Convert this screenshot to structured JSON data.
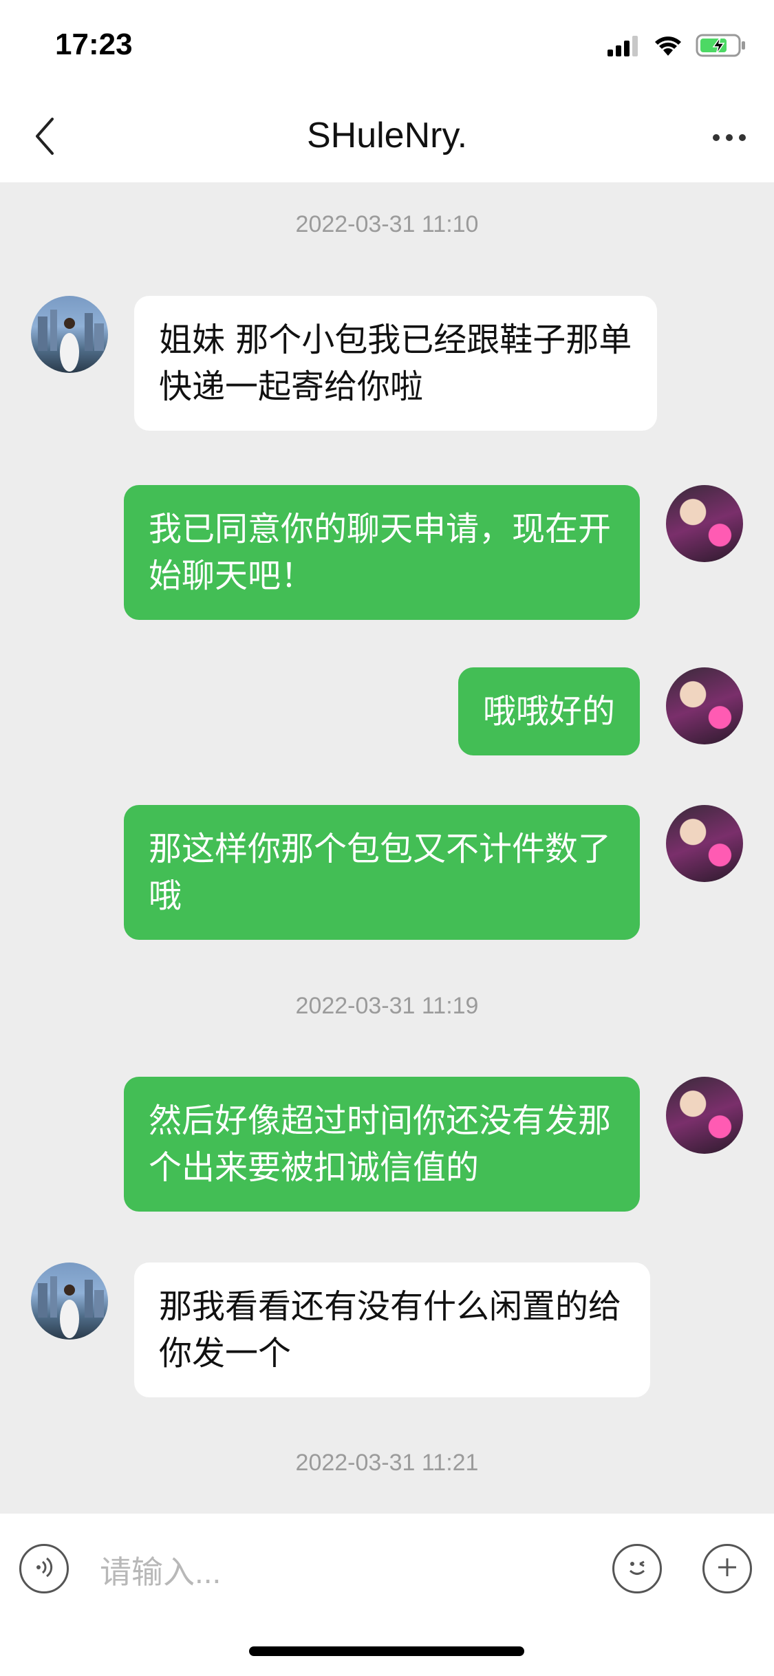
{
  "status": {
    "time": "17:23"
  },
  "header": {
    "title": "SHuleNry."
  },
  "messages": [
    {
      "type": "timestamp",
      "text": "2022-03-31 11:10"
    },
    {
      "type": "incoming",
      "text": "姐妹 那个小包我已经跟鞋子那单快递一起寄给你啦"
    },
    {
      "type": "outgoing",
      "text": "我已同意你的聊天申请，现在开始聊天吧！"
    },
    {
      "type": "outgoing",
      "text": "哦哦好的"
    },
    {
      "type": "outgoing",
      "text": "那这样你那个包包又不计件数了哦"
    },
    {
      "type": "timestamp",
      "text": "2022-03-31 11:19"
    },
    {
      "type": "outgoing",
      "text": "然后好像超过时间你还没有发那个出来要被扣诚信值的"
    },
    {
      "type": "incoming",
      "text": "那我看看还有没有什么闲置的给你发一个"
    },
    {
      "type": "timestamp",
      "text": "2022-03-31 11:21"
    }
  ],
  "input": {
    "placeholder": "请输入..."
  },
  "icons": {
    "back": "chevron-left-icon",
    "more": "more-dots-icon",
    "voice": "voice-icon",
    "emoji": "emoji-icon",
    "add": "plus-icon",
    "signal": "signal-icon",
    "wifi": "wifi-icon",
    "battery": "battery-charging-icon"
  },
  "colors": {
    "outgoing_bubble": "#43be55",
    "incoming_bubble": "#ffffff",
    "background": "#ededed"
  }
}
